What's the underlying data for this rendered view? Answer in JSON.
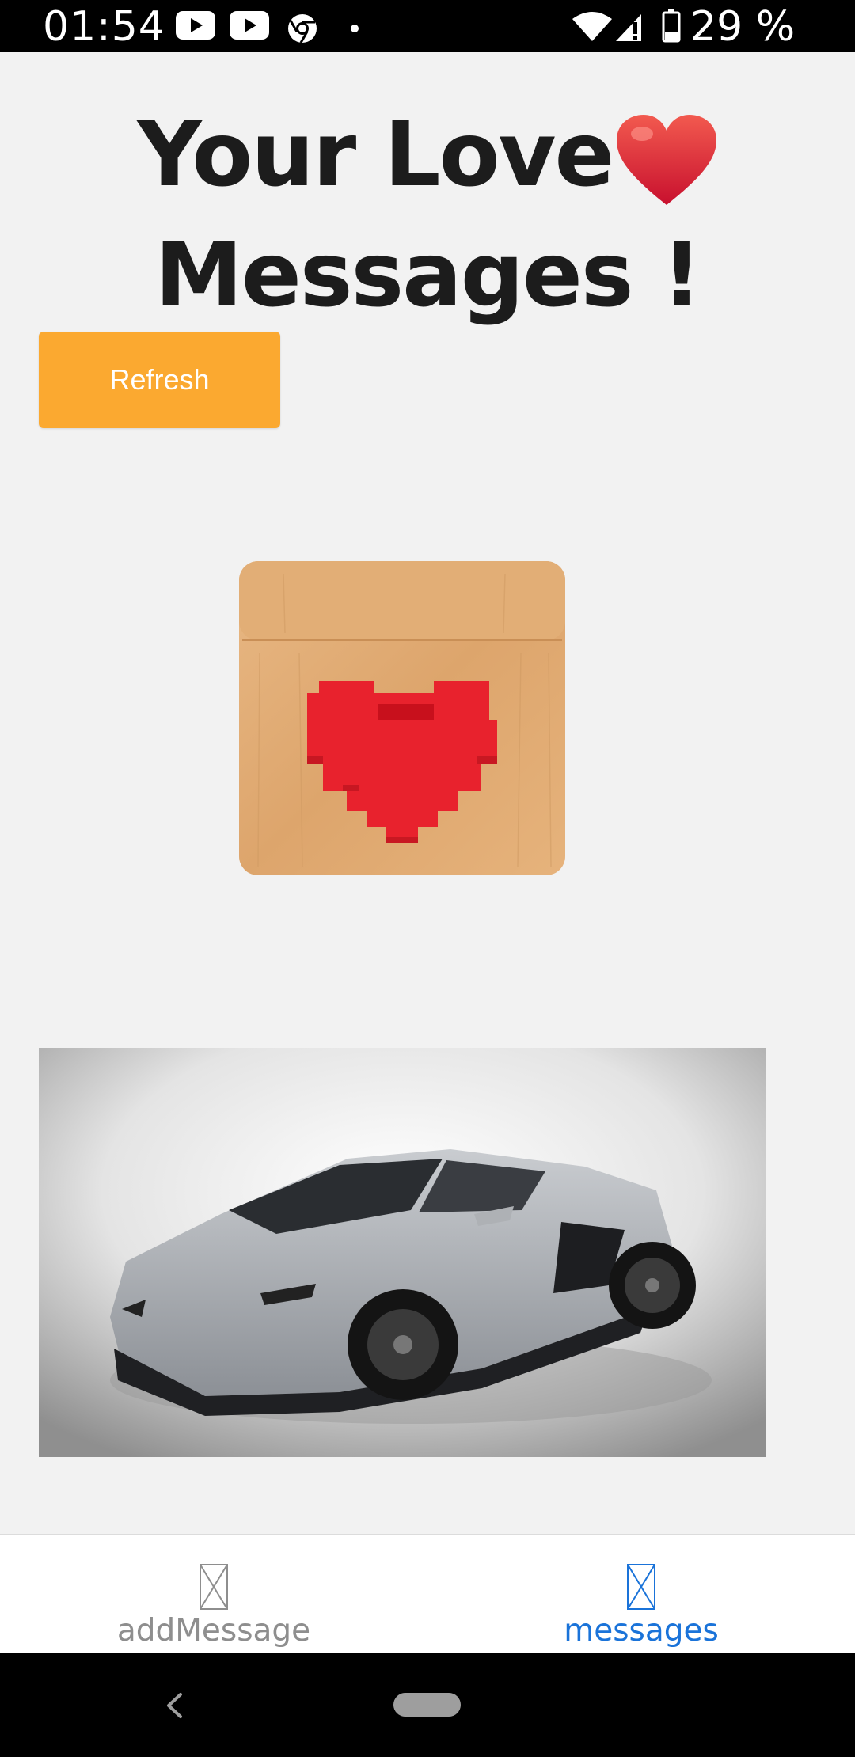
{
  "status_bar": {
    "time": "01:54",
    "battery_text": "29 %",
    "icons": [
      "youtube-icon",
      "youtube-icon",
      "chrome-icon",
      "notification-dot-icon",
      "wifi-icon",
      "signal-icon",
      "battery-icon"
    ]
  },
  "main": {
    "title": "Your Love",
    "title_emoji": "heart-emoji",
    "title_line2": "Messages !",
    "refresh_label": "Refresh",
    "images": [
      "lovebox-heart-image",
      "car-image"
    ]
  },
  "tab_bar": {
    "tabs": [
      {
        "label": "addMessage",
        "icon": "missing-image-icon",
        "active": false
      },
      {
        "label": "messages",
        "icon": "missing-image-icon",
        "active": true
      }
    ]
  },
  "colors": {
    "accent": "#fba930",
    "active_tab": "#1a73d9",
    "inactive_tab": "#8e8e8e",
    "background": "#f2f2f2"
  }
}
